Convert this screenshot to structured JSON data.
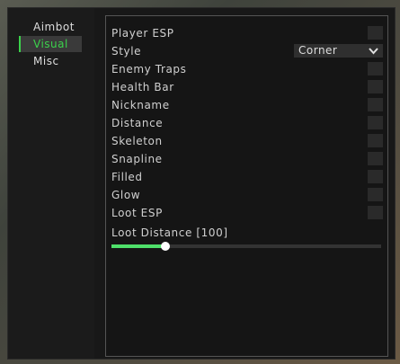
{
  "sidebar": {
    "items": [
      {
        "label": "Aimbot",
        "active": false
      },
      {
        "label": "Visual",
        "active": true
      },
      {
        "label": "Misc",
        "active": false
      }
    ]
  },
  "visual": {
    "player_esp": "Player ESP",
    "style_label": "Style",
    "style_value": "Corner",
    "enemy_traps": "Enemy Traps",
    "health_bar": "Health Bar",
    "nickname": "Nickname",
    "distance": "Distance",
    "skeleton": "Skeleton",
    "snapline": "Snapline",
    "filled": "Filled",
    "glow": "Glow",
    "loot_esp": "Loot ESP",
    "loot_distance_label": "Loot Distance [100]",
    "loot_distance_fraction": 0.2
  },
  "colors": {
    "accent": "#3bd24b",
    "slider_fill": "#4fe06a"
  }
}
